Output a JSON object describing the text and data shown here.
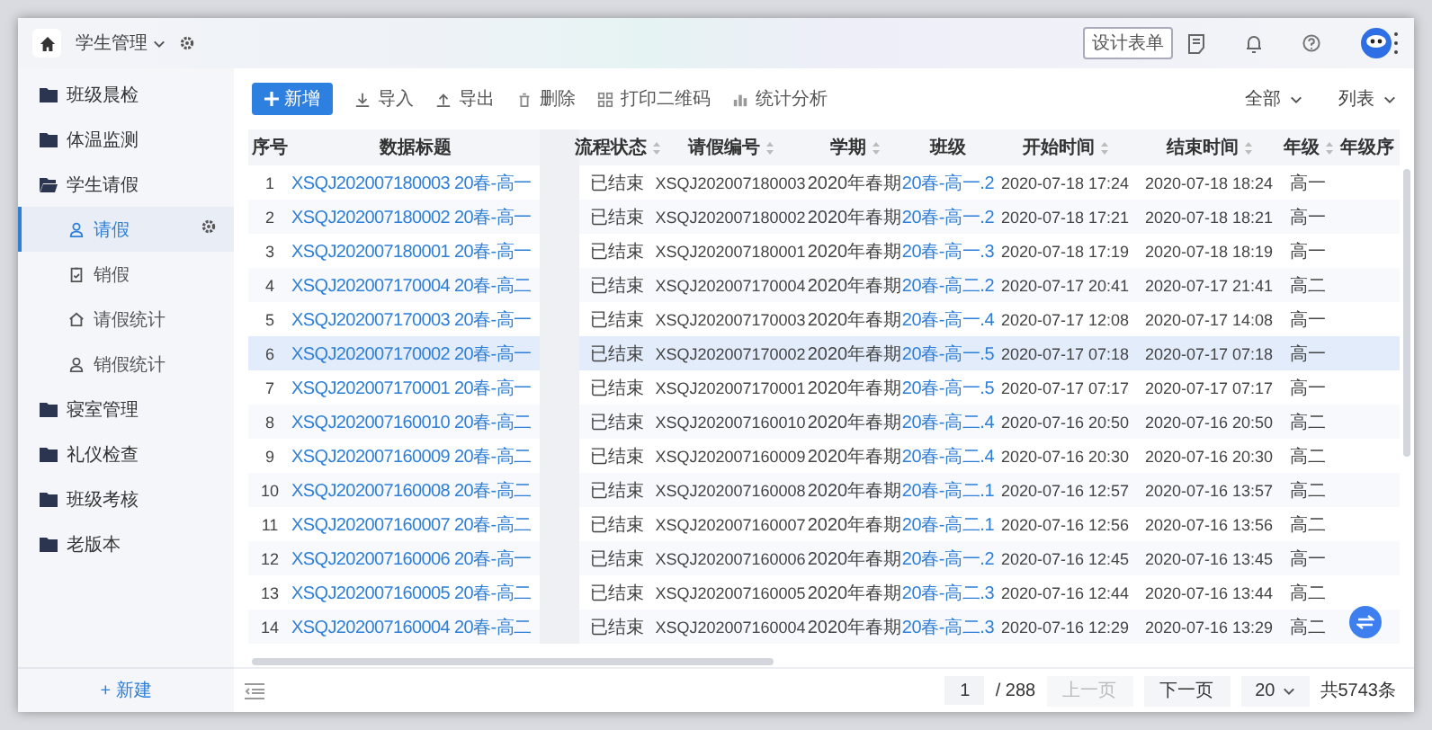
{
  "top_bar": {
    "module": "学生管理",
    "design_button": "设计表单"
  },
  "sidebar": {
    "items": [
      {
        "label": "班级晨检",
        "expanded": false
      },
      {
        "label": "体温监测",
        "expanded": false
      },
      {
        "label": "学生请假",
        "expanded": true,
        "children": [
          {
            "label": "请假",
            "selected": true,
            "kind": "person"
          },
          {
            "label": "销假",
            "selected": false,
            "kind": "clipboard"
          },
          {
            "label": "请假统计",
            "selected": false,
            "kind": "home"
          },
          {
            "label": "销假统计",
            "selected": false,
            "kind": "person"
          }
        ]
      },
      {
        "label": "寝室管理",
        "expanded": false
      },
      {
        "label": "礼仪检查",
        "expanded": false
      },
      {
        "label": "班级考核",
        "expanded": false
      },
      {
        "label": "老版本",
        "expanded": false
      }
    ],
    "new_button": "+ 新建"
  },
  "toolbar": {
    "primary": "新增",
    "actions": [
      {
        "label": "导入",
        "kind": "download"
      },
      {
        "label": "导出",
        "kind": "upload"
      },
      {
        "label": "删除",
        "kind": "trash"
      },
      {
        "label": "打印二维码",
        "kind": "grid"
      },
      {
        "label": "统计分析",
        "kind": "chart"
      }
    ],
    "filters": [
      "全部",
      "列表"
    ]
  },
  "table": {
    "columns": [
      {
        "label": "序号",
        "kind": "index",
        "sortable": false
      },
      {
        "label": "数据标题",
        "kind": "link",
        "sortable": false
      },
      {
        "label": "流程状态",
        "kind": "text",
        "sortable": true
      },
      {
        "label": "请假编号",
        "kind": "number",
        "sortable": true
      },
      {
        "label": "学期",
        "kind": "text",
        "sortable": true
      },
      {
        "label": "班级",
        "kind": "link",
        "sortable": false
      },
      {
        "label": "开始时间",
        "kind": "number",
        "sortable": true
      },
      {
        "label": "结束时间",
        "kind": "number",
        "sortable": true
      },
      {
        "label": "年级",
        "kind": "text",
        "sortable": true
      },
      {
        "label": "年级序",
        "sortable": false
      }
    ],
    "rows": [
      {
        "highlighted": false,
        "cells": [
          "1",
          "XSQJ202007180003 20春-高一",
          "已结束",
          "XSQJ202007180003",
          "2020年春期",
          "20春-高一.2",
          "2020-07-18 17:24",
          "2020-07-18 18:24",
          "高一"
        ]
      },
      {
        "highlighted": false,
        "cells": [
          "2",
          "XSQJ202007180002 20春-高一",
          "已结束",
          "XSQJ202007180002",
          "2020年春期",
          "20春-高一.2",
          "2020-07-18 17:21",
          "2020-07-18 18:21",
          "高一"
        ]
      },
      {
        "highlighted": false,
        "cells": [
          "3",
          "XSQJ202007180001 20春-高一",
          "已结束",
          "XSQJ202007180001",
          "2020年春期",
          "20春-高一.3",
          "2020-07-18 17:19",
          "2020-07-18 18:19",
          "高一"
        ]
      },
      {
        "highlighted": false,
        "cells": [
          "4",
          "XSQJ202007170004 20春-高二",
          "已结束",
          "XSQJ202007170004",
          "2020年春期",
          "20春-高二.2",
          "2020-07-17 20:41",
          "2020-07-17 21:41",
          "高二"
        ]
      },
      {
        "highlighted": false,
        "cells": [
          "5",
          "XSQJ202007170003 20春-高一",
          "已结束",
          "XSQJ202007170003",
          "2020年春期",
          "20春-高一.4",
          "2020-07-17 12:08",
          "2020-07-17 14:08",
          "高一"
        ]
      },
      {
        "highlighted": true,
        "cells": [
          "6",
          "XSQJ202007170002 20春-高一",
          "已结束",
          "XSQJ202007170002",
          "2020年春期",
          "20春-高一.5",
          "2020-07-17 07:18",
          "2020-07-17 07:18",
          "高一"
        ]
      },
      {
        "highlighted": false,
        "cells": [
          "7",
          "XSQJ202007170001 20春-高一",
          "已结束",
          "XSQJ202007170001",
          "2020年春期",
          "20春-高一.5",
          "2020-07-17 07:17",
          "2020-07-17 07:17",
          "高一"
        ]
      },
      {
        "highlighted": false,
        "cells": [
          "8",
          "XSQJ202007160010 20春-高二",
          "已结束",
          "XSQJ202007160010",
          "2020年春期",
          "20春-高二.4",
          "2020-07-16 20:50",
          "2020-07-16 20:50",
          "高二"
        ]
      },
      {
        "highlighted": false,
        "cells": [
          "9",
          "XSQJ202007160009 20春-高二",
          "已结束",
          "XSQJ202007160009",
          "2020年春期",
          "20春-高二.4",
          "2020-07-16 20:30",
          "2020-07-16 20:30",
          "高二"
        ]
      },
      {
        "highlighted": false,
        "cells": [
          "10",
          "XSQJ202007160008 20春-高二",
          "已结束",
          "XSQJ202007160008",
          "2020年春期",
          "20春-高二.1",
          "2020-07-16 12:57",
          "2020-07-16 13:57",
          "高二"
        ]
      },
      {
        "highlighted": false,
        "cells": [
          "11",
          "XSQJ202007160007 20春-高二",
          "已结束",
          "XSQJ202007160007",
          "2020年春期",
          "20春-高二.1",
          "2020-07-16 12:56",
          "2020-07-16 13:56",
          "高二"
        ]
      },
      {
        "highlighted": false,
        "cells": [
          "12",
          "XSQJ202007160006 20春-高一",
          "已结束",
          "XSQJ202007160006",
          "2020年春期",
          "20春-高一.2",
          "2020-07-16 12:45",
          "2020-07-16 13:45",
          "高一"
        ]
      },
      {
        "highlighted": false,
        "cells": [
          "13",
          "XSQJ202007160005 20春-高二",
          "已结束",
          "XSQJ202007160005",
          "2020年春期",
          "20春-高二.3",
          "2020-07-16 12:44",
          "2020-07-16 13:44",
          "高二"
        ]
      },
      {
        "highlighted": false,
        "cells": [
          "14",
          "XSQJ202007160004 20春-高二",
          "已结束",
          "XSQJ202007160004",
          "2020年春期",
          "20春-高二.3",
          "2020-07-16 12:29",
          "2020-07-16 13:29",
          "高二"
        ]
      }
    ]
  },
  "pagination": {
    "page": "1",
    "total_pages": "/ 288",
    "prev": {
      "label": "上一页",
      "disabled": true
    },
    "next": {
      "label": "下一页",
      "disabled": false
    },
    "page_size": "20",
    "total": "共5743条"
  }
}
